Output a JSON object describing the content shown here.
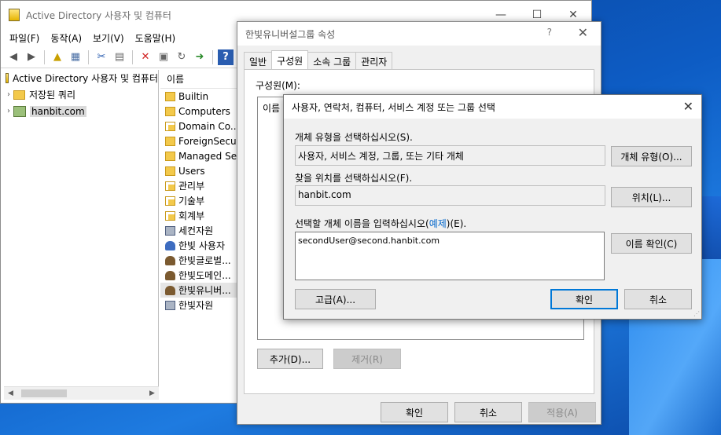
{
  "main_window": {
    "title": "Active Directory 사용자 및 컴퓨터",
    "controls": {
      "minimize": "—",
      "maximize": "☐",
      "close": "✕"
    },
    "menu": [
      "파일(F)",
      "동작(A)",
      "보기(V)",
      "도움말(H)"
    ],
    "tree": {
      "root": "Active Directory 사용자 및 컴퓨터",
      "items": [
        "저장된 쿼리",
        "hanbit.com"
      ]
    },
    "list": {
      "header": "이름",
      "items": [
        "Builtin",
        "Computers",
        "Domain Co...",
        "ForeignSecu...",
        "Managed Se...",
        "Users",
        "관리부",
        "기술부",
        "회계부",
        "세컨자원",
        "한빛 사용자",
        "한빛글로벌...",
        "한빛도메인...",
        "한빛유니버...",
        "한빛자원"
      ],
      "icons": [
        "folder",
        "folder",
        "ou",
        "folder",
        "folder",
        "folder",
        "ou",
        "ou",
        "ou",
        "share",
        "user",
        "group",
        "group",
        "group",
        "share"
      ]
    }
  },
  "properties_dialog": {
    "title": "한빛유니버설그룹 속성",
    "help": "?",
    "close": "✕",
    "tabs": [
      "일반",
      "구성원",
      "소속 그룹",
      "관리자"
    ],
    "active_tab": "구성원",
    "members_label": "구성원(M):",
    "members_header": "이름",
    "add_button": "추가(D)...",
    "remove_button": "제거(R)",
    "ok": "확인",
    "cancel": "취소",
    "apply": "적용(A)"
  },
  "select_dialog": {
    "title": "사용자, 연락처, 컴퓨터, 서비스 계정 또는 그룹 선택",
    "close": "✕",
    "object_type_label": "개체 유형을 선택하십시오(S).",
    "object_type_value": "사용자, 서비스 계정, 그룹, 또는 기타 개체",
    "object_type_button": "개체 유형(O)...",
    "location_label": "찾을 위치를 선택하십시오(F).",
    "location_value": "hanbit.com",
    "location_button": "위치(L)...",
    "name_label_prefix": "선택할 개체 이름을 입력하십시오(",
    "name_label_link": "예제",
    "name_label_suffix": ")(E).",
    "name_value": "secondUser@second.hanbit.com",
    "check_names_button": "이름 확인(C)",
    "advanced_button": "고급(A)...",
    "ok": "확인",
    "cancel": "취소"
  }
}
